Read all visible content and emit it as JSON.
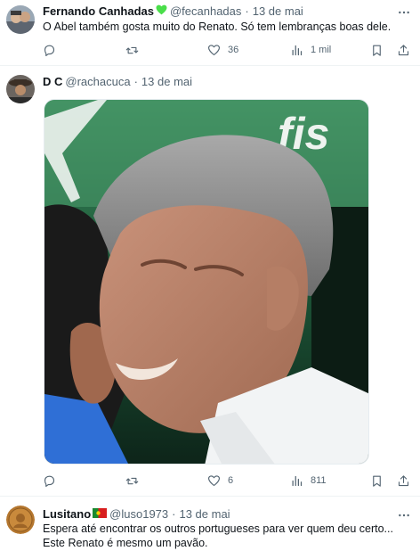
{
  "tweets": [
    {
      "name": "Fernando Canhadas",
      "badge_icon": "green-heart-icon",
      "handle": "@fecanhadas",
      "separator": "·",
      "time": "13 de mai",
      "text": "O Abel também gosta muito do Renato. Só tem lembranças boas dele.",
      "actions": {
        "replies": "",
        "retweets": "",
        "likes": "36",
        "views": "1 mil"
      }
    },
    {
      "name": "D C",
      "handle": "@rachacuca",
      "separator": "·",
      "time": "13 de mai",
      "text": "",
      "media": {
        "alt": "Foto de Renato com cabelo grisalho abraçando alguém",
        "banner_text": "fis"
      },
      "actions": {
        "replies": "",
        "retweets": "",
        "likes": "6",
        "views": "811"
      }
    },
    {
      "name": "Lusitano",
      "badge_icon": "portugal-flag-icon",
      "handle": "@luso1973",
      "separator": "·",
      "time": "13 de mai",
      "text_line1": "Espera até encontrar os outros portugueses para ver quem deu certo...",
      "text_line2": "Este Renato é mesmo um pavão."
    }
  ],
  "colors": {
    "text": "#0f1419",
    "secondary": "#536471",
    "divider": "#eff3f4",
    "heart_badge": "#4ade4a"
  }
}
